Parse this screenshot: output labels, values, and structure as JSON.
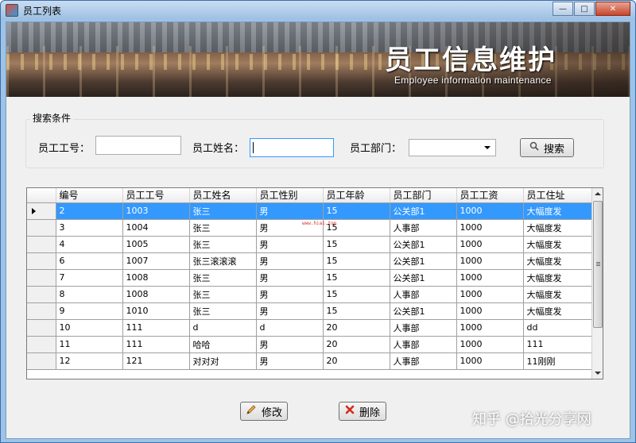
{
  "window": {
    "title": "员工列表"
  },
  "banner": {
    "title": "员工信息维护",
    "subtitle": "Employee information maintenance"
  },
  "search": {
    "group_label": "搜索条件",
    "emp_no_label": "员工工号：",
    "emp_no_value": "",
    "emp_name_label": "员工姓名：",
    "emp_name_value": "",
    "dept_label": "员工部门：",
    "dept_value": "",
    "search_button": "搜索"
  },
  "table": {
    "columns": [
      "编号",
      "员工工号",
      "员工姓名",
      "员工性别",
      "员工年龄",
      "员工部门",
      "员工工资",
      "员工住址"
    ],
    "rows": [
      [
        "2",
        "1003",
        "张三",
        "男",
        "15",
        "公关部1",
        "1000",
        "大幅度发"
      ],
      [
        "3",
        "1004",
        "张三",
        "男",
        "15",
        "人事部",
        "1000",
        "大幅度发"
      ],
      [
        "4",
        "1005",
        "张三",
        "男",
        "15",
        "公关部1",
        "1000",
        "大幅度发"
      ],
      [
        "6",
        "1007",
        "张三滚滚滚",
        "男",
        "15",
        "公关部1",
        "1000",
        "大幅度发"
      ],
      [
        "7",
        "1008",
        "张三",
        "男",
        "15",
        "公关部1",
        "1000",
        "大幅度发"
      ],
      [
        "8",
        "1008",
        "张三",
        "男",
        "15",
        "人事部",
        "1000",
        "大幅度发"
      ],
      [
        "9",
        "1010",
        "张三",
        "男",
        "15",
        "公关部1",
        "1000",
        "大幅度发"
      ],
      [
        "10",
        "111",
        "d",
        "d",
        "20",
        "人事部",
        "1000",
        "dd"
      ],
      [
        "11",
        "111",
        "哈哈",
        "男",
        "20",
        "人事部",
        "1000",
        "111"
      ],
      [
        "12",
        "121",
        "对对对",
        "男",
        "20",
        "人事部",
        "1000",
        "11刚刚"
      ]
    ],
    "selected_row": 0
  },
  "buttons": {
    "edit": "修改",
    "delete": "删除"
  },
  "overlay": {
    "small_watermark": "www.hiai.top",
    "corner_watermark": "知乎 @拾光分享网"
  }
}
